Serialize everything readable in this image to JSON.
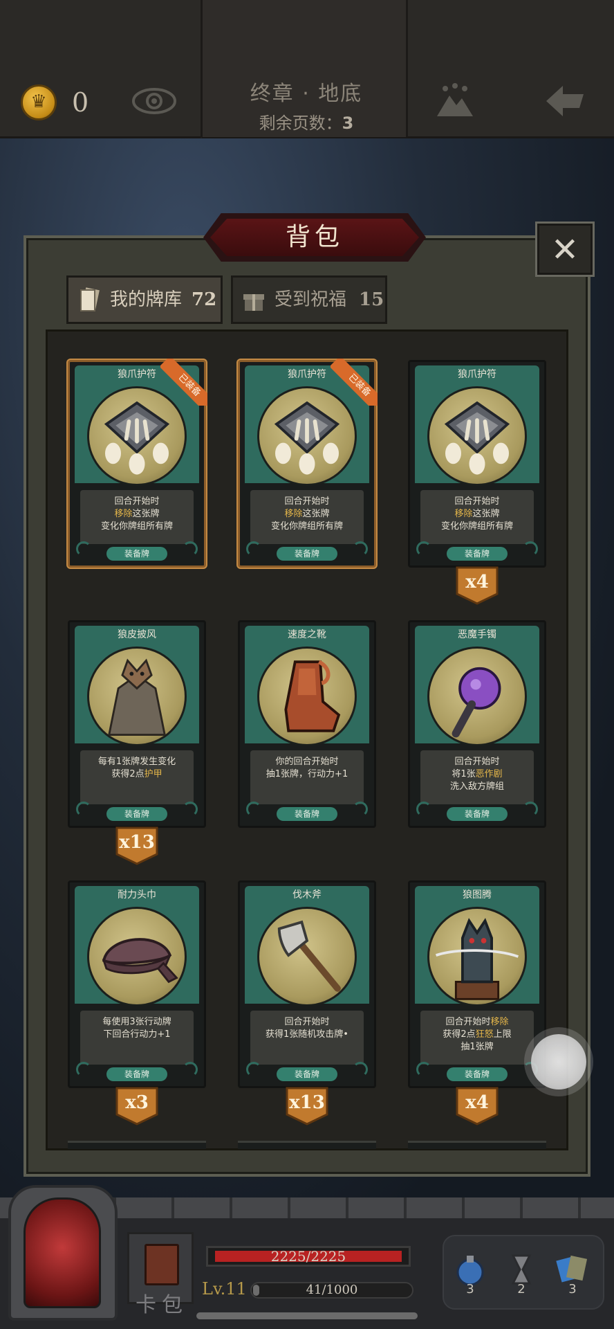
{
  "header": {
    "coins": "0",
    "chapter": "终章 · 地底",
    "pages_label": "剩余页数：",
    "pages_value": "3"
  },
  "bag": {
    "title": "背包",
    "close_symbol": "✕",
    "tabs": [
      {
        "label": "我的牌库",
        "count": "72"
      },
      {
        "label": "受到祝福",
        "count": "15"
      }
    ]
  },
  "cards": [
    {
      "name": "狼爪护符",
      "desc": [
        "回合开始时",
        "移除这张牌",
        "变化你牌组所有牌"
      ],
      "type": "装备牌",
      "equipped": true,
      "equipped_label": "已装备",
      "count": ""
    },
    {
      "name": "狼爪护符",
      "desc": [
        "回合开始时",
        "移除这张牌",
        "变化你牌组所有牌"
      ],
      "type": "装备牌",
      "equipped": true,
      "equipped_label": "已装备",
      "count": ""
    },
    {
      "name": "狼爪护符",
      "desc": [
        "回合开始时",
        "移除这张牌",
        "变化你牌组所有牌"
      ],
      "type": "装备牌",
      "equipped": false,
      "count": "x4"
    },
    {
      "name": "狼皮披风",
      "desc": [
        "每有1张牌发生变化",
        "获得2点护甲"
      ],
      "type": "装备牌",
      "equipped": false,
      "count": "x13"
    },
    {
      "name": "速度之靴",
      "desc": [
        "你的回合开始时",
        "抽1张牌，行动力+1"
      ],
      "type": "装备牌",
      "equipped": false,
      "count": ""
    },
    {
      "name": "恶魔手镯",
      "desc": [
        "回合开始时",
        "将1张恶作剧",
        "洗入敌方牌组"
      ],
      "type": "装备牌",
      "equipped": false,
      "count": ""
    },
    {
      "name": "耐力头巾",
      "desc": [
        "每使用3张行动牌",
        "下回合行动力+1"
      ],
      "type": "装备牌",
      "equipped": false,
      "count": "x3"
    },
    {
      "name": "伐木斧",
      "desc": [
        "回合开始时",
        "获得1张随机攻击牌•"
      ],
      "type": "装备牌",
      "equipped": false,
      "count": "x13"
    },
    {
      "name": "狼图腾",
      "desc": [
        "回合开始时移除",
        "获得2点狂怒上限",
        "抽1张牌"
      ],
      "type": "装备牌",
      "equipped": false,
      "count": "x4"
    }
  ],
  "player": {
    "hp_text": "2225/2225",
    "hp_fraction": 1.0,
    "level": "Lv.11",
    "xp_text": "41/1000",
    "xp_fraction": 0.041,
    "cardpack_label": "卡包",
    "items": [
      {
        "icon": "potion-icon",
        "count": "3"
      },
      {
        "icon": "hourglass-icon",
        "count": "2"
      },
      {
        "icon": "cards-icon",
        "count": "3"
      }
    ]
  },
  "colors": {
    "card_green": "#2f6b5e",
    "highlight_gold": "#e4b64a",
    "equip_orange": "#d86a2a",
    "hp_red": "#b82222"
  }
}
